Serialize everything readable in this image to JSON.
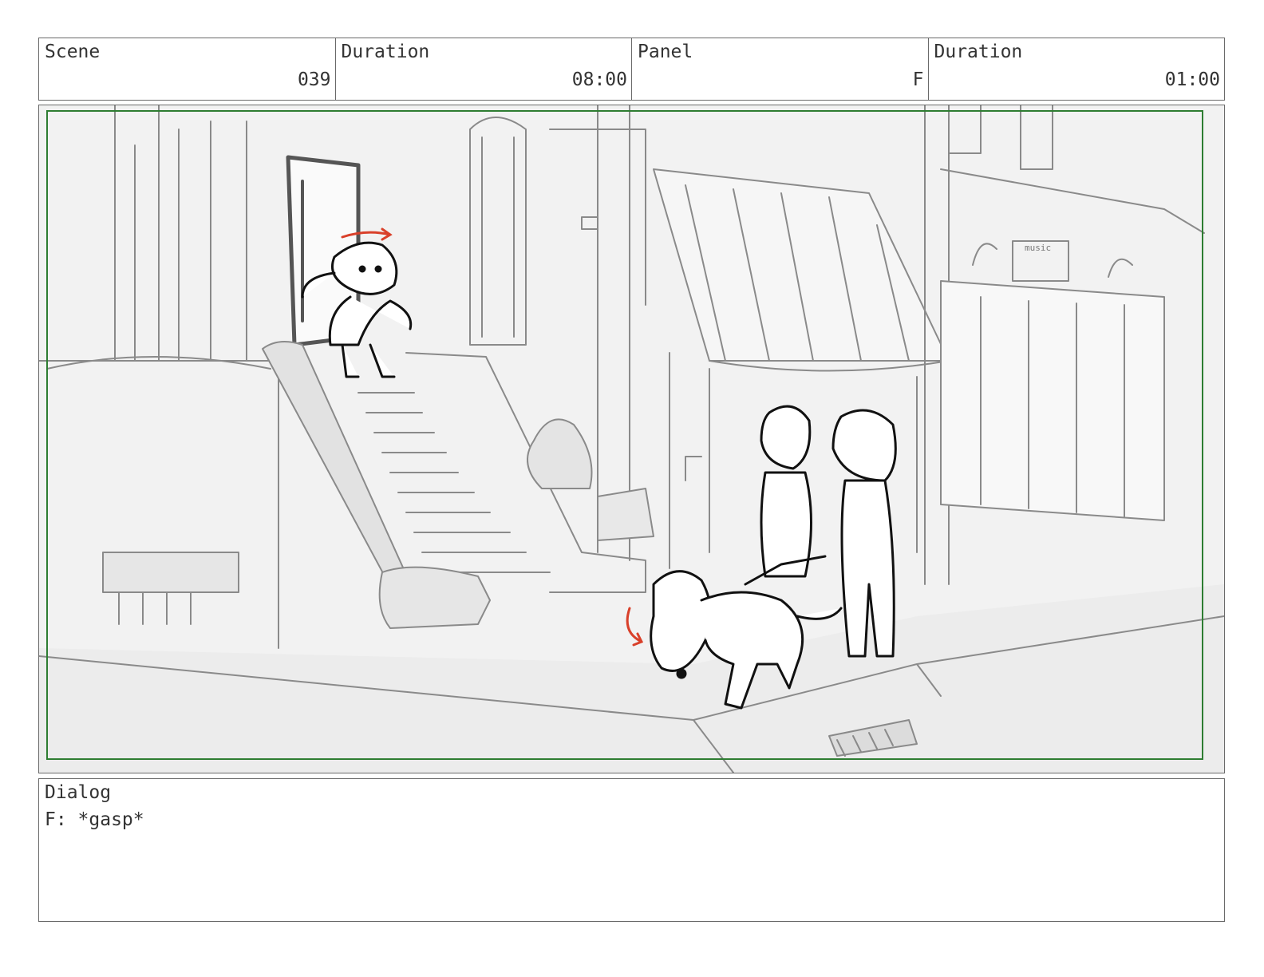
{
  "header": {
    "scene": {
      "label": "Scene",
      "value": "039"
    },
    "scene_duration": {
      "label": "Duration",
      "value": "08:00"
    },
    "panel": {
      "label": "Panel",
      "value": "F"
    },
    "panel_duration": {
      "label": "Duration",
      "value": "01:00"
    }
  },
  "artwork": {
    "sign_text": "music",
    "safe_frame_color": "#2e7d32",
    "action_arrow_color": "#d9402a"
  },
  "dialog": {
    "label": "Dialog",
    "text": "F: *gasp*"
  }
}
